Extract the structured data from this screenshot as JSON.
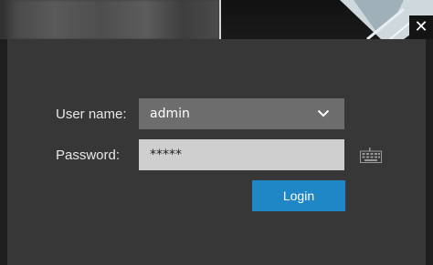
{
  "window": {
    "close_symbol": "✕"
  },
  "form": {
    "username_label": "User name:",
    "username_value": "admin",
    "password_label": "Password:",
    "password_value": "*****",
    "login_label": "Login"
  },
  "icons": {
    "close": "close-icon",
    "dropdown": "chevron-down-icon",
    "keyboard": "keyboard-icon"
  },
  "colors": {
    "dialog_bg": "#373737",
    "select_bg": "#6d6d6d",
    "input_bg": "#cfcfcf",
    "login_bg": "#1f87c6"
  }
}
